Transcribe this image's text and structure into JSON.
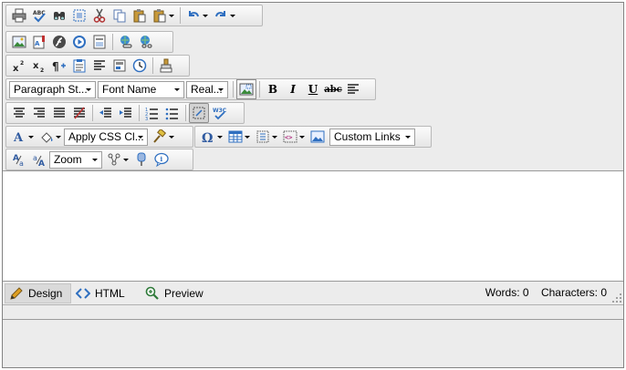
{
  "dropdowns": {
    "paragraph_style": "Paragraph St...",
    "font_name": "Font Name",
    "font_size": "Real...",
    "css_class": "Apply CSS Cl...",
    "custom_links": "Custom Links",
    "zoom": "Zoom"
  },
  "format_buttons": {
    "bold": "B",
    "italic": "I",
    "underline": "U",
    "strike": "abc"
  },
  "modes": {
    "design": "Design",
    "html": "HTML",
    "preview": "Preview"
  },
  "stats": {
    "words_label": "Words:",
    "words_value": "0",
    "chars_label": "Characters:",
    "chars_value": "0"
  },
  "colors": {
    "accent_blue": "#2f6fc0",
    "toolbar_bg": "#ececec"
  }
}
